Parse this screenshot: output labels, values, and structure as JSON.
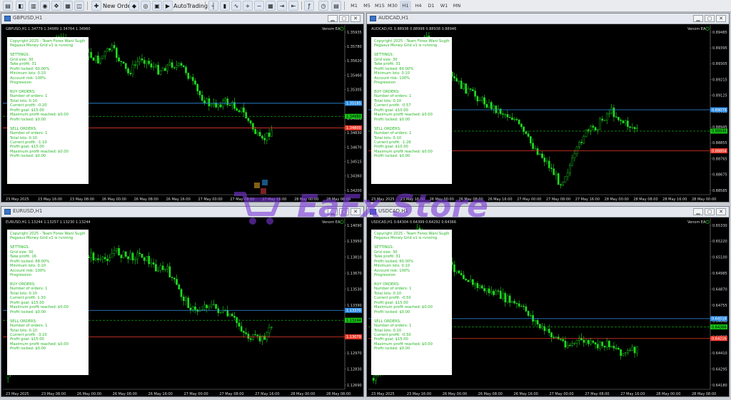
{
  "toolbar": {
    "new_order_label": "New Order",
    "autotrading_label": "AutoTrading",
    "timeframes": [
      "M1",
      "M5",
      "M15",
      "M30",
      "H1",
      "H4",
      "D1",
      "W1",
      "MN"
    ],
    "active_timeframe": "H1"
  },
  "windows": [
    {
      "title": "GBPUSD,H1",
      "ohlc_line": "GBPUSD,H1  1.34779 1.34989 1.34764 1.34960",
      "ea_label": "Venom EA",
      "price_axis": [
        "1.35935",
        "1.35780",
        "1.35620",
        "1.35460",
        "1.35305",
        "1.35145",
        "1.34985",
        "1.34830",
        "1.34670",
        "1.34515",
        "1.34360",
        "1.34200"
      ],
      "tags": [
        {
          "price": "1.35185",
          "color": "#2f8fe8"
        },
        {
          "price": "1.34980",
          "color": "#15c515"
        },
        {
          "price": "1.34800",
          "color": "#ee3a2a"
        }
      ],
      "time_axis": [
        "23 May 2025",
        "23 May 16:00",
        "23 May 08:00",
        "26 May 00:00",
        "26 May 08:00",
        "26 May 16:00",
        "27 May 00:00",
        "27 May 08:00",
        "27 May 16:00",
        "28 May 00:00",
        "28 May 08:00"
      ]
    },
    {
      "title": "AUDCAD,H1",
      "ohlc_line": "AUDCAD,H1  0.88938 0.88998 0.88938 0.88946",
      "ea_label": "Venom EA",
      "price_axis": [
        "0.89485",
        "0.89395",
        "0.89305",
        "0.89215",
        "0.89125",
        "0.89035",
        "0.88945",
        "0.88855",
        "0.88765",
        "0.88675",
        "0.88585"
      ],
      "tags": [
        {
          "price": "0.89079",
          "color": "#2f8fe8"
        },
        {
          "price": "0.88946",
          "color": "#15c515"
        },
        {
          "price": "0.88804",
          "color": "#ee3a2a"
        }
      ],
      "time_axis": [
        "23 May 2025",
        "23 May 16:00",
        "26 May 00:00",
        "26 May 08:00",
        "26 May 16:00",
        "27 May 00:00",
        "27 May 08:00",
        "27 May 16:00",
        "28 May 00:00",
        "28 May 08:00",
        "28 May 16:00",
        "28 May 00:00"
      ]
    },
    {
      "title": "EURUSD,H1",
      "ohlc_line": "EURUSD,H1  1.13244 1.13257 1.13230 1.13244",
      "ea_label": "Venom EA",
      "price_axis": [
        "1.14090",
        "1.13950",
        "1.13810",
        "1.13670",
        "1.13530",
        "1.13390",
        "1.13250",
        "1.13110",
        "1.12970",
        "1.12830",
        "1.12690"
      ],
      "tags": [
        {
          "price": "1.13370",
          "color": "#2f8fe8"
        },
        {
          "price": "1.13244",
          "color": "#15c515"
        },
        {
          "price": "1.13079",
          "color": "#ee3a2a"
        }
      ],
      "time_axis": [
        "23 May 2025",
        "23 May 08:00",
        "26 May 00:00",
        "26 May 08:00",
        "26 May 16:00",
        "27 May 00:00",
        "27 May 08:00",
        "27 May 16:00",
        "28 May 00:00",
        "28 May 08:00"
      ]
    },
    {
      "title": "USDCAD,H1",
      "ohlc_line": "USDCAD,H1  0.64304 0.64399 0.64292 0.64366",
      "ea_label": "Venom EA",
      "price_axis": [
        "0.65330",
        "0.65220",
        "0.65100",
        "0.64985",
        "0.64870",
        "0.64755",
        "0.64640",
        "0.64525",
        "0.64410",
        "0.64295",
        "0.64180"
      ],
      "tags": [
        {
          "price": "0.64518",
          "color": "#2f8fe8"
        },
        {
          "price": "0.64366",
          "color": "#15c515"
        },
        {
          "price": "0.64216",
          "color": "#ee3a2a"
        }
      ],
      "time_axis": [
        "23 May 2025",
        "23 May 16:00",
        "26 May 00:00",
        "26 May 08:00",
        "26 May 16:00",
        "27 May 00:00",
        "27 May 08:00",
        "27 May 16:00",
        "28 May 00:00",
        "28 May 08:00"
      ]
    }
  ],
  "info_panels": [
    {
      "lines": [
        "Copyright 2025 - Team Forex Wani Sugih",
        "Pegasus Money Grid v1 is running",
        "",
        "SETTINGS:",
        "Grid size: 30",
        "Take profit: 31",
        "Profit locked: 60.00%",
        "Minimum lots: 0.10",
        "Account risk: 100%",
        "Progression",
        "",
        "BUY ORDERS:",
        "Number of orders: 1",
        "Total lots: 0.10",
        "Current profit: -0.20",
        "Profit goal: $15.00",
        "Maximum profit reached: $0.00",
        "Profit locked: $0.00",
        "",
        "SELL ORDERS:",
        "Number of orders: 1",
        "Total lots: 0.10",
        "Current profit: -1.10",
        "Profit goal: $15.00",
        "Maximum profit reached: $0.00",
        "Profit locked: $0.00"
      ]
    },
    {
      "lines": [
        "Copyright 2025 - Team Forex Wani Sugih",
        "Pegasus Money Grid v1 is running",
        "",
        "SETTINGS:",
        "Grid size: 30",
        "Take profit: 31",
        "Profit locked: 60.00%",
        "Minimum lots: 0.10",
        "Account risk: 100%",
        "Progression",
        "",
        "BUY ORDERS:",
        "Number of orders: 1",
        "Total lots: 0.10",
        "Current profit: -0.57",
        "Profit goal: $10.00",
        "Maximum profit reached: $0.00",
        "Profit locked: $0.00",
        "",
        "SELL ORDERS:",
        "Number of orders: 1",
        "Total lots: 0.10",
        "Current profit: -1.26",
        "Profit goal: $10.00",
        "Maximum profit reached: $0.00",
        "Profit locked: $0.00"
      ]
    },
    {
      "lines": [
        "Copyright 2025 - Team Forex Wani Sugih",
        "Pegasus Money Grid v1 is running",
        "",
        "SETTINGS:",
        "Grid size: 30",
        "Take profit: 16",
        "Profit locked: 68.00%",
        "Minimum lots: 0.10",
        "Account risk: 100%",
        "Progression",
        "",
        "BUY ORDERS:",
        "Number of orders: 1",
        "Total lots: 0.10",
        "Current profit: 1.30",
        "Profit goal: $15.00",
        "Maximum profit reached: $0.00",
        "Profit locked: $0.00",
        "",
        "SELL ORDERS:",
        "Number of orders: 1",
        "Total lots: 0.10",
        "Current profit: -3.10",
        "Profit goal: $15.00",
        "Maximum profit reached: $0.00",
        "Profit locked: $0.00"
      ]
    },
    {
      "lines": [
        "Copyright 2025 - Team Forex Wani Sugih",
        "Pegasus Money Grid v1 is running",
        "",
        "SETTINGS:",
        "Grid size: 30",
        "Take profit: 31",
        "Profit locked: 60.00%",
        "Minimum lots: 0.10",
        "Account risk: 100%",
        "Progression",
        "",
        "BUY ORDERS:",
        "Number of orders: 1",
        "Total lots: 0.10",
        "Current profit: -0.50",
        "Profit goal: $15.00",
        "Maximum profit reached: $0.00",
        "Profit locked: $0.00",
        "",
        "SELL ORDERS:",
        "Number of orders: 1",
        "Total lots: 0.10",
        "Current profit: -0.50",
        "Profit goal: $15.00",
        "Maximum profit reached: $0.00",
        "Profit locked: $0.00"
      ]
    }
  ],
  "watermark": {
    "text": "EaFx Store"
  },
  "colors": {
    "bull": "#1fdc1f",
    "bear": "#1fdc1f",
    "buy_line": "#2f8fe8",
    "sell_line": "#ee3a2a",
    "bid_line": "#15c515",
    "text": "#d8d8d8"
  }
}
